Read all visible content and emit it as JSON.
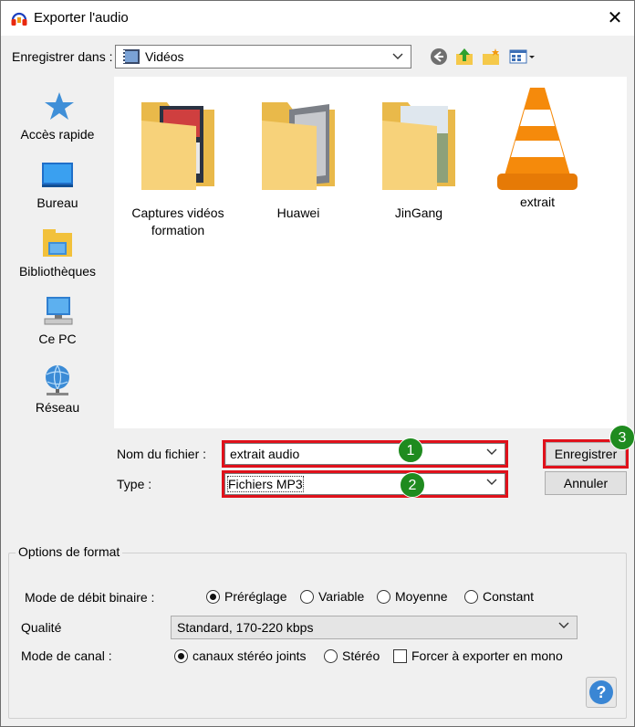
{
  "window": {
    "title": "Exporter l'audio",
    "close_glyph": "✕"
  },
  "save_in": {
    "label": "Enregistrer dans :",
    "label_accel": "d",
    "value": "Vidéos",
    "folder_icon": "video-folder-icon",
    "toolbar_icons": [
      "back-icon",
      "up-folder-icon",
      "new-folder-icon",
      "view-menu-icon"
    ]
  },
  "places": [
    {
      "label": "Accès rapide",
      "icon": "star-icon"
    },
    {
      "label": "Bureau",
      "icon": "desktop-icon"
    },
    {
      "label": "Bibliothèques",
      "icon": "library-icon"
    },
    {
      "label": "Ce PC",
      "icon": "computer-icon"
    },
    {
      "label": "Réseau",
      "icon": "network-icon"
    }
  ],
  "files": [
    {
      "name_line1": "Captures vidéos",
      "name_line2": "formation",
      "type": "folder"
    },
    {
      "name_line1": "Huawei",
      "name_line2": "",
      "type": "folder"
    },
    {
      "name_line1": "JinGang",
      "name_line2": "",
      "type": "folder"
    },
    {
      "name_line1": "extrait",
      "name_line2": "",
      "type": "vlc-file"
    }
  ],
  "filename": {
    "label": "Nom du fichier :",
    "value": "extrait audio"
  },
  "filetype": {
    "label": "Type :",
    "value": "Fichiers MP3"
  },
  "buttons": {
    "save": "Enregistrer",
    "cancel": "Annuler",
    "help": "?"
  },
  "badges": [
    "1",
    "2",
    "3"
  ],
  "format_options": {
    "title": "Options de format",
    "bitrate_mode_label": "Mode de débit binaire :",
    "bitrate_modes": [
      {
        "label": "Préréglage",
        "selected": true
      },
      {
        "label": "Variable",
        "selected": false
      },
      {
        "label": "Moyenne",
        "selected": false
      },
      {
        "label": "Constant",
        "selected": false
      }
    ],
    "quality_label": "Qualité",
    "quality_value": "Standard, 170-220 kbps",
    "channel_mode_label": "Mode de canal :",
    "channel_modes": [
      {
        "label": "canaux stéréo joints",
        "selected": true
      },
      {
        "label": "Stéréo",
        "selected": false
      }
    ],
    "force_mono_label": "Forcer à exporter en mono",
    "force_mono_checked": false
  },
  "colors": {
    "highlight_red": "#e0111b",
    "badge_green": "#1f8b1f"
  }
}
